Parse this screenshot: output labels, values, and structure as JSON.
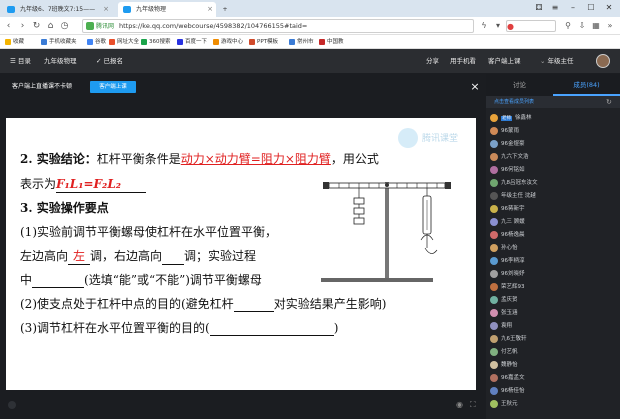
{
  "browser": {
    "tabs": [
      {
        "title": "九年级6、7班晚文7:15——",
        "icon": "qq-classroom-icon"
      },
      {
        "title": "九年级物理",
        "icon": "qq-classroom-icon"
      }
    ],
    "window_controls": [
      "min-icon",
      "max-icon",
      "close-icon"
    ],
    "address": {
      "secure_label": "腾讯网",
      "url": "https://ke.qq.com/webcourse/4598382/104766155#taid="
    },
    "bookmarks": [
      {
        "label": "收藏",
        "color": "#f5b400"
      },
      {
        "label": "手机收藏夹",
        "color": "#3a7bd5"
      },
      {
        "label": "谷歌",
        "color": "#4285f4"
      },
      {
        "label": "网址大全",
        "color": "#e94f2b"
      },
      {
        "label": "360搜索",
        "color": "#1aa34a"
      },
      {
        "label": "百度一下",
        "color": "#2932e1"
      },
      {
        "label": "游戏中心",
        "color": "#f08c00"
      },
      {
        "label": "PPT模板",
        "color": "#d04a2b"
      },
      {
        "label": "常州市",
        "color": "#3a7bd5"
      },
      {
        "label": "中国教",
        "color": "#c62828"
      }
    ]
  },
  "site_header": {
    "menu_label": "☰ 目录",
    "course_name": "九年级物理",
    "enrolled": "✓ 已报名",
    "share": "分享",
    "phone": "用手机看",
    "client": "客户端上课",
    "user": "年级主任"
  },
  "video_header": {
    "notice": "客户端上直播课不卡顿",
    "button": "客户端上课",
    "close": "×"
  },
  "slide": {
    "watermark": "腾讯课堂",
    "line1_label": "2. 实验结论：",
    "line1_text": "杠杆平衡条件是",
    "line1_answer": "动力×动力臂=阻力×阻力臂",
    "line1_tail": "，用公式",
    "line2_text": "表示为",
    "line2_answer": "F₁L₁=F₂L₂",
    "line3": "3. 实验操作要点",
    "line4": "(1)实验前调节平衡螺母使杠杆在水平位置平衡，",
    "line5_a": "左边高向",
    "line5_answer": "左",
    "line5_b": "调，右边高向",
    "line5_c": "调；实验过程",
    "line6_a": "中",
    "line6_b": "(选填“能”或“不能”)调节平衡螺母",
    "line7_a": "(2)使支点处于杠杆中点的目的(避免杠杆",
    "line7_b": "对实验结果产生影响)",
    "line8_a": "(3)调节杠杆在水平位置平衡的目的(",
    "line8_b": ")"
  },
  "sidebar": {
    "tab_discuss": "讨论",
    "tab_members": "成员(84)",
    "select_label": "点击查看成员列表",
    "members": [
      {
        "name": "徐鑫林",
        "color": "#e8a23a",
        "tag": "老师"
      },
      {
        "name": "96蒙雨",
        "color": "#d08a56"
      },
      {
        "name": "96金煜豪",
        "color": "#7aa0c8"
      },
      {
        "name": "九六下文浩",
        "color": "#c98a5a"
      },
      {
        "name": "96何铭如",
        "color": "#b06fa0"
      },
      {
        "name": "九8吕冠东汝文",
        "color": "#6fa56f"
      },
      {
        "name": "年级主任 沈越",
        "color": "#555"
      },
      {
        "name": "96蒋新宇",
        "color": "#c9b14a"
      },
      {
        "name": "九三 顾媛",
        "color": "#8a8fd0"
      },
      {
        "name": "96杨逸晨",
        "color": "#d06a6a"
      },
      {
        "name": "孙心怡",
        "color": "#d0a060"
      },
      {
        "name": "96李柄淳",
        "color": "#5a9ad0"
      },
      {
        "name": "96刘晓妤",
        "color": "#a0a0a0"
      },
      {
        "name": "荣艺辉93",
        "color": "#c07040"
      },
      {
        "name": "孟庆贺",
        "color": "#70b0a0"
      },
      {
        "name": "张玉涵",
        "color": "#d08fb0"
      },
      {
        "name": "袁翔",
        "color": "#9090c0"
      },
      {
        "name": "九6王敬轩",
        "color": "#c0a070"
      },
      {
        "name": "付艺帆",
        "color": "#80b080"
      },
      {
        "name": "魏静怡",
        "color": "#d0c0a0"
      },
      {
        "name": "96嘉孟文",
        "color": "#b07060"
      },
      {
        "name": "96杨佳怡",
        "color": "#6080c0"
      },
      {
        "name": "王秋元",
        "color": "#a0c060"
      }
    ]
  }
}
